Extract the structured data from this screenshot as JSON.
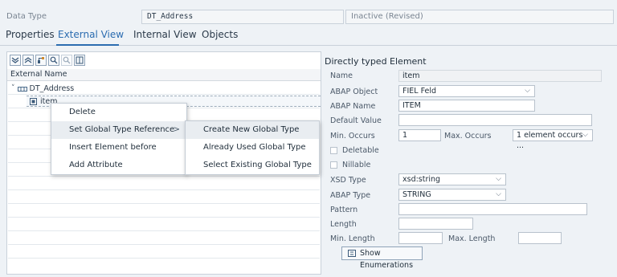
{
  "header": {
    "data_type_label": "Data Type",
    "data_type_value": "DT_Address",
    "status": "Inactive (Revised)"
  },
  "tabs": [
    {
      "label": "Properties",
      "active": false
    },
    {
      "label": "External View",
      "active": true
    },
    {
      "label": "Internal View",
      "active": false
    },
    {
      "label": "Objects",
      "active": false
    }
  ],
  "toolbar": {
    "icons": [
      "expand-all-icon",
      "collapse-all-icon",
      "hierarchy-icon",
      "search-icon",
      "search-next-icon",
      "column-layout-icon"
    ]
  },
  "tree": {
    "column_header": "External Name",
    "root": {
      "label": "DT_Address",
      "toggle": "˅",
      "icon": "structure-icon"
    },
    "child": {
      "label": "item",
      "icon": "element-icon"
    }
  },
  "context_menu": {
    "items": [
      {
        "label": "Delete",
        "mnemonic": "D"
      },
      {
        "label": "Set Global Type Reference",
        "mnemonic": "S",
        "has_submenu": true
      },
      {
        "label": "Insert Element before",
        "mnemonic": "I"
      },
      {
        "label": "Add Attribute",
        "mnemonic": "A"
      }
    ],
    "submenu_arrow": ">",
    "submenu": [
      {
        "label": "Create New Global Type"
      },
      {
        "label": "Already Used Global Type"
      },
      {
        "label": "Select Existing Global Type"
      }
    ]
  },
  "element_panel": {
    "title": "Directly typed Element",
    "name_label": "Name",
    "name_value": "item",
    "abap_object_label": "ABAP Object",
    "abap_object_value": "FIEL Feld",
    "abap_name_label": "ABAP Name",
    "abap_name_value": "ITEM",
    "default_value_label": "Default Value",
    "default_value": "",
    "min_occurs_label": "Min. Occurs",
    "min_occurs_value": "1",
    "max_occurs_label": "Max. Occurs",
    "max_occurs_value": "1 element occurs ...",
    "deletable_label": "Deletable",
    "nillable_label": "Nillable",
    "xsd_type_label": "XSD Type",
    "xsd_type_value": "xsd:string",
    "abap_type_label": "ABAP Type",
    "abap_type_value": "STRING",
    "pattern_label": "Pattern",
    "pattern_value": "",
    "length_label": "Length",
    "length_value": "",
    "min_length_label": "Min. Length",
    "min_length_value": "",
    "max_length_label": "Max. Length",
    "max_length_value": "",
    "show_enum_label": "Show Enumerations",
    "dropdown_arrow": "⌵"
  },
  "colors": {
    "accent": "#2b6cb0",
    "background": "#eef2f6"
  }
}
